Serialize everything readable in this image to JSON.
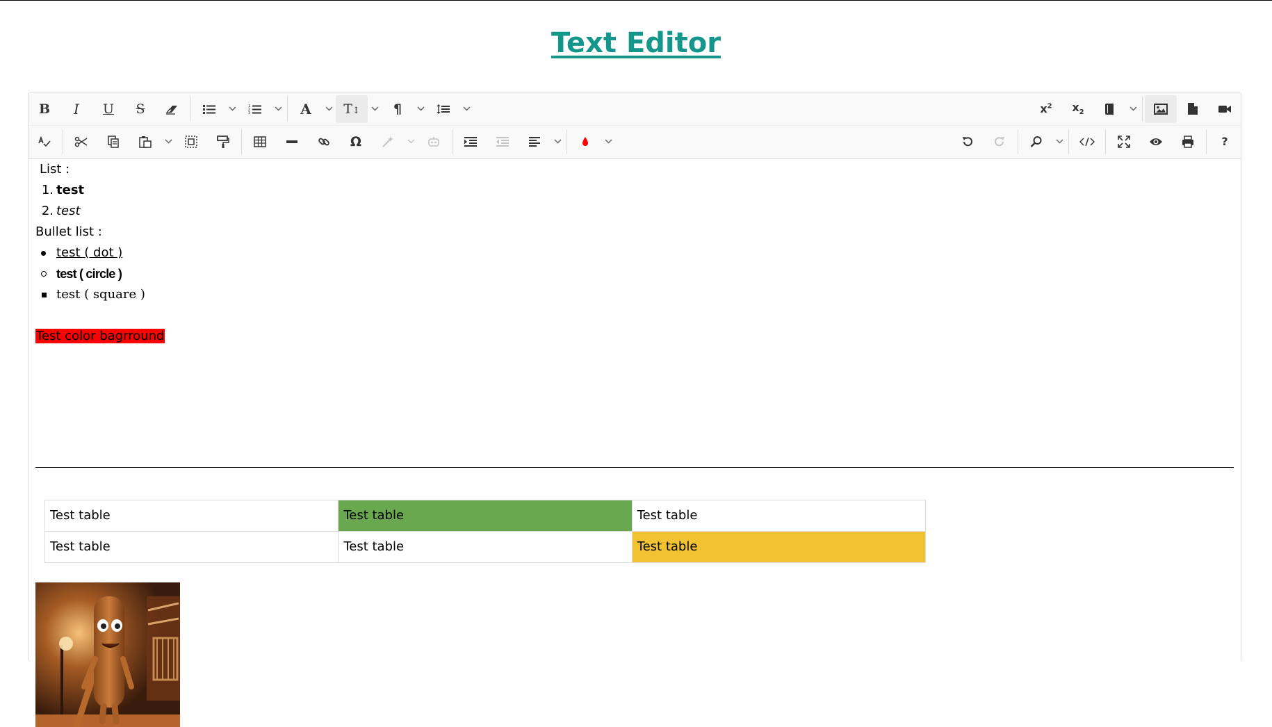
{
  "page": {
    "title": "Text Editor"
  },
  "colors": {
    "title": "#14968a",
    "highlight_red": "#ff0000",
    "cell_green": "#6aa84f",
    "cell_yellow": "#f1c232",
    "active_button_bg": "#ebebeb"
  },
  "toolbar": {
    "row1_left": [
      {
        "icon": "bold-icon",
        "label": "B"
      },
      {
        "icon": "italic-icon",
        "label": "I"
      },
      {
        "icon": "underline-icon",
        "label": "U"
      },
      {
        "icon": "strikethrough-icon",
        "label": "S"
      },
      {
        "icon": "eraser-icon"
      },
      {
        "icon": "bulleted-list-icon",
        "dropdown": true
      },
      {
        "icon": "numbered-list-icon",
        "dropdown": true
      },
      {
        "icon": "font-icon",
        "label": "A",
        "dropdown": true
      },
      {
        "icon": "font-size-icon",
        "label": "T↕",
        "dropdown": true,
        "active": true
      },
      {
        "icon": "paragraph-icon",
        "label": "¶",
        "dropdown": true
      },
      {
        "icon": "line-height-icon",
        "dropdown": true
      }
    ],
    "row1_right": [
      {
        "icon": "superscript-icon",
        "label": "x²"
      },
      {
        "icon": "subscript-icon",
        "label": "x₂"
      },
      {
        "icon": "file-icon",
        "dropdown": true
      },
      {
        "icon": "image-icon",
        "active": true
      },
      {
        "icon": "document-icon"
      },
      {
        "icon": "video-icon"
      }
    ],
    "row2_left": [
      {
        "icon": "spellcheck-icon"
      },
      {
        "icon": "cut-icon"
      },
      {
        "icon": "copy-icon"
      },
      {
        "icon": "paste-icon",
        "dropdown": true
      },
      {
        "icon": "select-all-icon"
      },
      {
        "icon": "format-painter-icon"
      },
      {
        "icon": "table-icon"
      },
      {
        "icon": "horizontal-line-icon"
      },
      {
        "icon": "link-icon"
      },
      {
        "icon": "special-character-icon",
        "label": "Ω"
      },
      {
        "icon": "magic-wand-icon",
        "dropdown": true,
        "disabled": true
      },
      {
        "icon": "ai-assistant-icon",
        "disabled": true
      },
      {
        "icon": "indent-icon"
      },
      {
        "icon": "outdent-icon",
        "disabled": true
      },
      {
        "icon": "align-left-icon",
        "dropdown": true
      },
      {
        "icon": "color-drop-icon",
        "dropdown": true
      }
    ],
    "row2_right": [
      {
        "icon": "undo-icon"
      },
      {
        "icon": "redo-icon",
        "disabled": true
      },
      {
        "icon": "search-icon",
        "dropdown": true
      },
      {
        "icon": "source-code-icon"
      },
      {
        "icon": "fullscreen-icon"
      },
      {
        "icon": "preview-icon"
      },
      {
        "icon": "print-icon"
      },
      {
        "icon": "help-icon",
        "label": "?"
      }
    ]
  },
  "content": {
    "list_label": "List :",
    "ordered_items": [
      {
        "number": "1.",
        "text": "test",
        "style": "bold"
      },
      {
        "number": "2.",
        "text": "test",
        "style": "italic"
      }
    ],
    "bullet_label": "Bullet list :",
    "bullet_items": [
      {
        "marker": "dot",
        "text": "test ( dot )",
        "style": "underline"
      },
      {
        "marker": "circle",
        "text": "test ( circle )",
        "style": "bold-condensed"
      },
      {
        "marker": "square",
        "text": "test ( square )",
        "style": "serif"
      }
    ],
    "highlight_text": "Test color bagrround",
    "table": [
      [
        "Test table",
        "Test table",
        "Test table"
      ],
      [
        "Test table",
        "Test table",
        "Test table"
      ]
    ],
    "image_alt": "3D cartoon character holding a bat at night"
  }
}
